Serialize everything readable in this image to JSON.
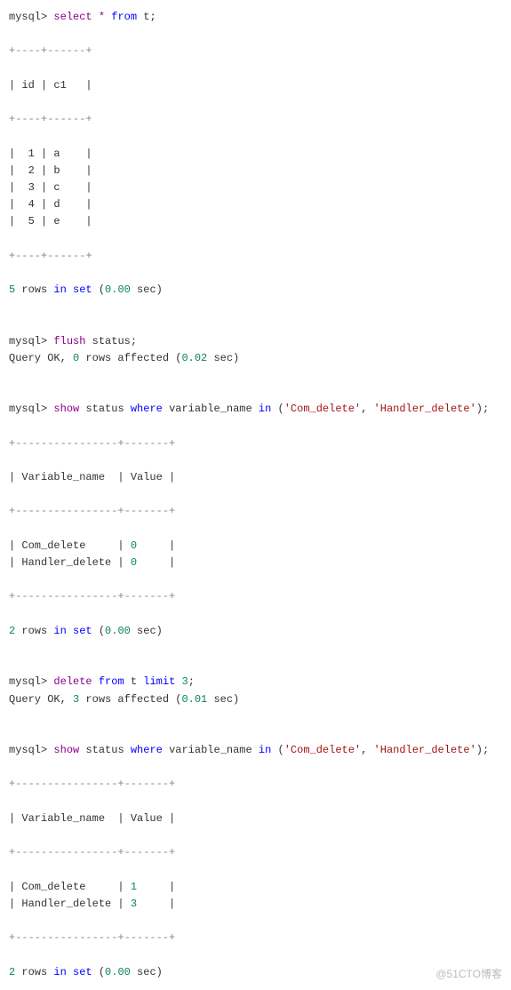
{
  "prompt": "mysql>",
  "queries": {
    "q1": {
      "select": "select",
      "star": "*",
      "from": "from",
      "table": "t;"
    },
    "q2": {
      "flush": "flush",
      "status": "status;"
    },
    "q3": {
      "show": "show",
      "status": "status",
      "where": "where",
      "varname": "variable_name",
      "in": "in",
      "lp": "(",
      "s1": "'Com_delete'",
      "comma": ",",
      "s2": "'Handler_delete'",
      "rp": ");"
    },
    "q4": {
      "delete": "delete",
      "from": "from",
      "table": "t",
      "limit": "limit",
      "n": "3",
      "semi": ";"
    }
  },
  "table1": {
    "border": "+----+------+",
    "header": "| id | c1   |",
    "rows": [
      "|  1 | a    |",
      "|  2 | b    |",
      "|  3 | c    |",
      "|  4 | d    |",
      "|  5 | e    |"
    ]
  },
  "result1a": "5",
  "result1b": " rows ",
  "result1c": "in",
  "result1d": " ",
  "result1e": "set",
  "result1f": " (",
  "result1g": "0.00",
  "result1h": " sec)",
  "result2a": "Query OK, ",
  "result2b": "0",
  "result2c": " rows affected (",
  "result2d": "0.02",
  "result2e": " sec)",
  "table3": {
    "border": "+----------------+-------+",
    "header": "| Variable_name  | Value |",
    "row1": "| Com_delete     | ",
    "row1v": "0",
    "row1e": "     |",
    "row2": "| Handler_delete | ",
    "row2v": "0",
    "row2e": "     |"
  },
  "result3a": "2",
  "result3b": " rows ",
  "result3c": "in",
  "result3d": " ",
  "result3e": "set",
  "result3f": " (",
  "result3g": "0.00",
  "result3h": " sec)",
  "result4a": "Query OK, ",
  "result4b": "3",
  "result4c": " rows affected (",
  "result4d": "0.01",
  "result4e": " sec)",
  "table5": {
    "border": "+----------------+-------+",
    "header": "| Variable_name  | Value |",
    "row1": "| Com_delete     | ",
    "row1v": "1",
    "row1e": "     |",
    "row2": "| Handler_delete | ",
    "row2v": "3",
    "row2e": "     |"
  },
  "watermark": "@51CTO博客"
}
